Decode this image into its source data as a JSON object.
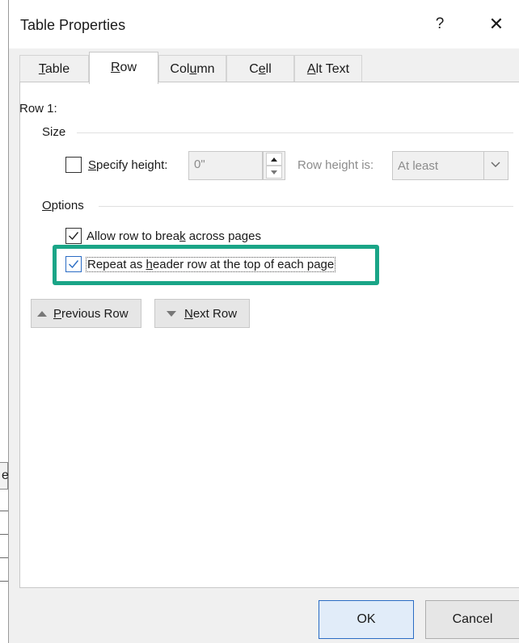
{
  "window": {
    "title": "Table Properties",
    "help_label": "?",
    "close_label": "✕"
  },
  "tabs": [
    {
      "pre": "",
      "key": "T",
      "post": "able",
      "active": false
    },
    {
      "pre": "",
      "key": "R",
      "post": "ow",
      "active": true
    },
    {
      "pre": "Col",
      "key": "u",
      "post": "mn",
      "active": false
    },
    {
      "pre": "C",
      "key": "e",
      "post": "ll",
      "active": false
    },
    {
      "pre": "",
      "key": "A",
      "post": "lt Text",
      "active": false
    }
  ],
  "row_panel": {
    "row_label": "Row 1:",
    "size_group": {
      "title": "Size",
      "specify_height": {
        "pre": "",
        "key": "S",
        "post": "pecify height:",
        "checked": false
      },
      "height_value": "0\"",
      "row_height_label": "Row height is:",
      "row_height_value": "At least"
    },
    "options_group": {
      "title_key": "O",
      "title_post": "ptions",
      "allow_break": {
        "pre": "Allow row to brea",
        "key": "k",
        "post": " across pages",
        "checked": true
      },
      "repeat_header": {
        "pre": "Repeat as ",
        "key": "h",
        "post": "eader row at the top of each page",
        "checked": true
      }
    },
    "prev_row": {
      "pre": "",
      "key": "P",
      "post": "revious Row"
    },
    "next_row": {
      "pre": "",
      "key": "N",
      "post": "ext Row"
    }
  },
  "footer": {
    "ok_label": "OK",
    "cancel_label": "Cancel"
  },
  "colors": {
    "highlight": "#1aa587",
    "checkbox_accent": "#2a6cc4"
  },
  "background_doc": {
    "visible_char": "e"
  }
}
